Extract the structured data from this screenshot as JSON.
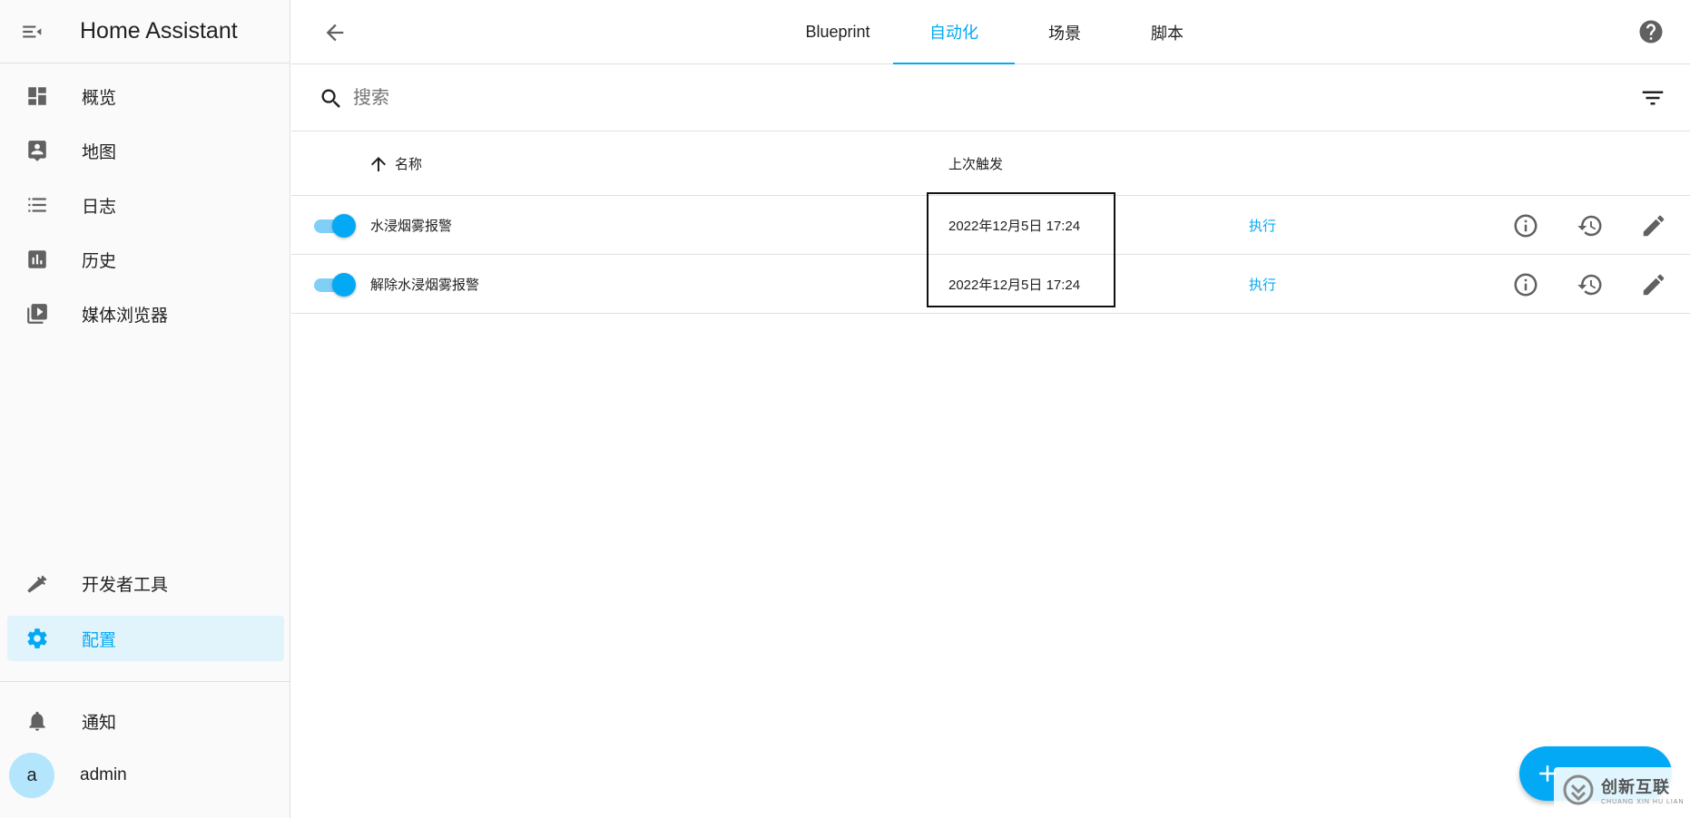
{
  "sidebar": {
    "title": "Home Assistant",
    "items": [
      {
        "label": "概览"
      },
      {
        "label": "地图"
      },
      {
        "label": "日志"
      },
      {
        "label": "历史"
      },
      {
        "label": "媒体浏览器"
      }
    ],
    "bottom_items": [
      {
        "label": "开发者工具"
      },
      {
        "label": "配置"
      }
    ],
    "notifications_label": "通知",
    "user": {
      "avatar_letter": "a",
      "name": "admin"
    }
  },
  "tabs": [
    {
      "label": "Blueprint"
    },
    {
      "label": "自动化"
    },
    {
      "label": "场景"
    },
    {
      "label": "脚本"
    }
  ],
  "search": {
    "placeholder": "搜索",
    "value": ""
  },
  "table": {
    "headers": {
      "name": "名称",
      "last_triggered": "上次触发"
    },
    "rows": [
      {
        "name": "水浸烟雾报警",
        "last_triggered": "2022年12月5日 17:24",
        "action": "执行",
        "enabled": true
      },
      {
        "name": "解除水浸烟雾报警",
        "last_triggered": "2022年12月5日 17:24",
        "action": "执行",
        "enabled": true
      }
    ]
  },
  "watermark": {
    "main": "创新互联",
    "sub": "CHUANG XIN HU LIAN"
  },
  "colors": {
    "accent": "#03a9f4",
    "active_bg": "#e1f4fb",
    "icon": "#616161"
  }
}
